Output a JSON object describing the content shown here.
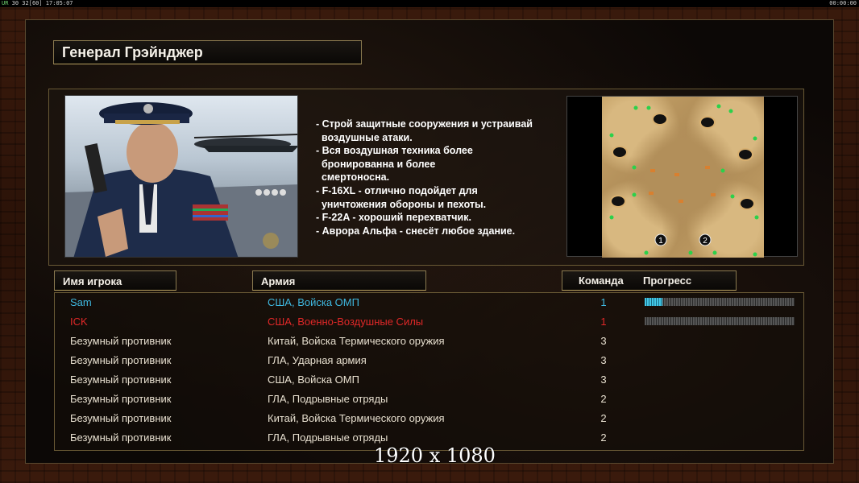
{
  "topbar": {
    "left_tag": "UR",
    "left_stats": "30 32[60] 17:05:07",
    "right_time": "00:00:00"
  },
  "general": {
    "title": "Генерал Грэйнджер",
    "description": [
      "- Строй защитные сооружения и устраивай",
      "  воздушные атаки.",
      "- Вся воздушная техника более",
      "  бронированна и более",
      "  смертоносна.",
      "- F-16XL - отлично подойдет для",
      "  уничтожения обороны и пехоты.",
      "- F-22A - хороший перехватчик.",
      "- Аврора Альфа - снесёт любое здание."
    ]
  },
  "minimap": {
    "start_positions": [
      "1",
      "2"
    ]
  },
  "table": {
    "headers": {
      "name": "Имя игрока",
      "army": "Армия",
      "team": "Команда",
      "progress": "Прогресс"
    },
    "rows": [
      {
        "name": "Sam",
        "army": "США, Войска ОМП",
        "team": "1",
        "color": "#3fb8e0",
        "progress": 0.12
      },
      {
        "name": "ICK",
        "army": "США, Военно-Воздушные Силы",
        "team": "1",
        "color": "#e02828",
        "progress": 0.0
      },
      {
        "name": "Безумный противник",
        "army": "Китай, Войска Термического оружия",
        "team": "3",
        "color": "#e8e0d0"
      },
      {
        "name": "Безумный противник",
        "army": "ГЛА, Ударная армия",
        "team": "3",
        "color": "#e8e0d0"
      },
      {
        "name": "Безумный противник",
        "army": "США, Войска ОМП",
        "team": "3",
        "color": "#e8e0d0"
      },
      {
        "name": "Безумный противник",
        "army": "ГЛА, Подрывные отряды",
        "team": "2",
        "color": "#e8e0d0"
      },
      {
        "name": "Безумный противник",
        "army": "Китай, Войска Термического оружия",
        "team": "2",
        "color": "#e8e0d0"
      },
      {
        "name": "Безумный противник",
        "army": "ГЛА, Подрывные отряды",
        "team": "2",
        "color": "#e8e0d0"
      }
    ]
  },
  "overlay": {
    "resolution": "1920 x 1080"
  }
}
